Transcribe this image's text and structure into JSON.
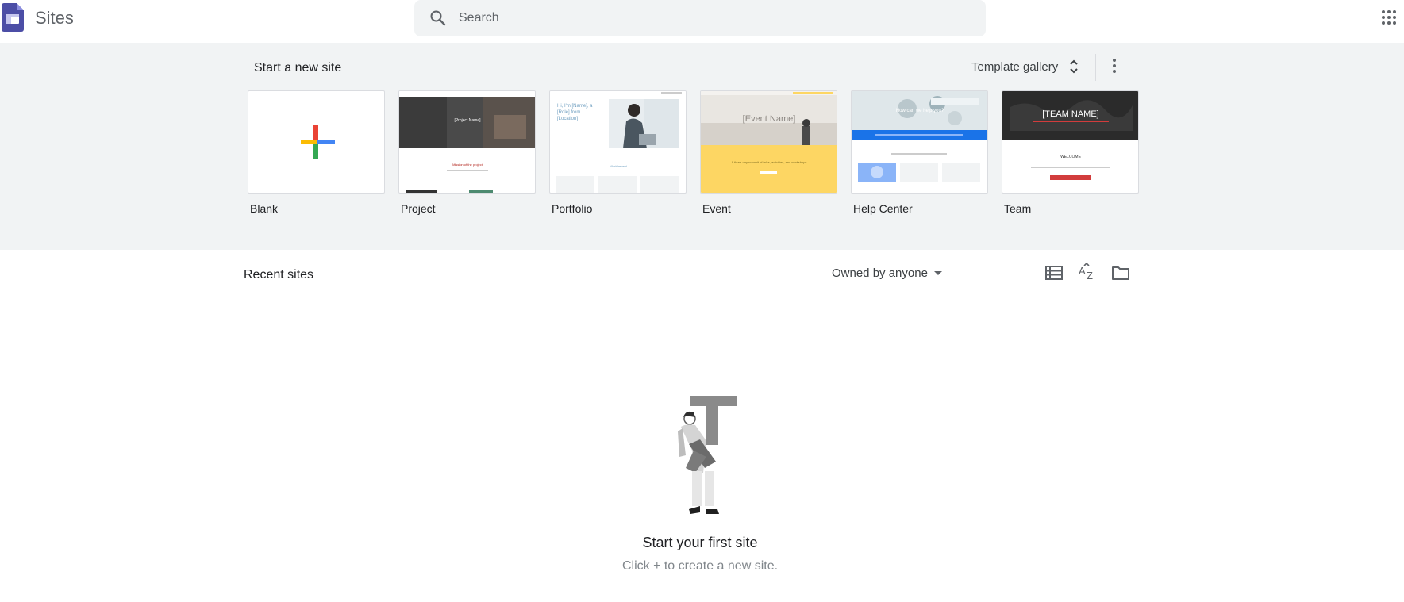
{
  "header": {
    "app_title": "Sites",
    "logo_icon": "sites-logo-icon",
    "search_placeholder": "Search",
    "search_value": "",
    "apps_icon": "apps-grid-icon"
  },
  "templates": {
    "section_label": "Start a new site",
    "gallery_label": "Template gallery",
    "items": [
      {
        "label": "Blank"
      },
      {
        "label": "Project"
      },
      {
        "label": "Portfolio"
      },
      {
        "label": "Event"
      },
      {
        "label": "Help Center"
      },
      {
        "label": "Team"
      }
    ],
    "thumb_text": {
      "project": {
        "banner": "[Project Name]",
        "heading": "Mission of the project"
      },
      "portfolio": {
        "intro": "Hi, I'm [Name], a [Role] from [Location]",
        "section": "Work/recent"
      },
      "event": {
        "name": "[Event Name]",
        "tagline": "A three-day summit of talks, activities, and workshops"
      },
      "helpcenter": {
        "question": "How can we help you?"
      },
      "team": {
        "banner": "[TEAM NAME]",
        "heading": "WELCOME"
      }
    }
  },
  "recent": {
    "title": "Recent sites",
    "owner_filter": "Owned by anyone"
  },
  "empty_state": {
    "title": "Start your first site",
    "subtitle": "Click + to create a new site."
  },
  "colors": {
    "sites_brand": "#4c4ea6",
    "google_red": "#ea4335",
    "google_yellow": "#fbbc04",
    "google_green": "#34a853",
    "google_blue": "#4285f4",
    "event_yellow": "#fdd663",
    "helpcenter_blue": "#1a73e8",
    "team_red": "#d23c3c"
  }
}
